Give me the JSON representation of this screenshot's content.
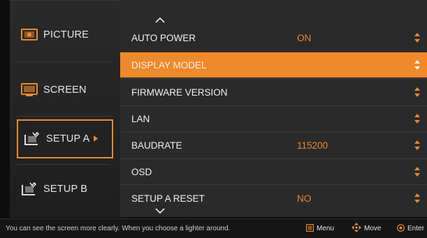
{
  "sidebar": {
    "items": [
      {
        "label": "PICTURE",
        "icon": "picture-icon"
      },
      {
        "label": "SCREEN",
        "icon": "screen-icon"
      },
      {
        "label": "SETUP A",
        "icon": "setup-a-icon",
        "selected": true
      },
      {
        "label": "SETUP B",
        "icon": "setup-b-icon"
      }
    ]
  },
  "menu": {
    "rows": [
      {
        "label": "AUTO POWER",
        "value": "ON"
      },
      {
        "label": "DISPLAY MODEL",
        "value": "",
        "selected": true
      },
      {
        "label": "FIRMWARE VERSION",
        "value": ""
      },
      {
        "label": "LAN",
        "value": ""
      },
      {
        "label": "BAUDRATE",
        "value": "115200"
      },
      {
        "label": "OSD",
        "value": ""
      },
      {
        "label": "SETUP A RESET",
        "value": "NO"
      }
    ]
  },
  "footer": {
    "hint": "You can see the screen more clearly.  When you choose a lighter around.",
    "menu_label": "Menu",
    "move_label": "Move",
    "enter_label": "Enter"
  },
  "colors": {
    "accent": "#f0892a",
    "panel": "#2a2a2a",
    "text": "#f2f2f2"
  }
}
